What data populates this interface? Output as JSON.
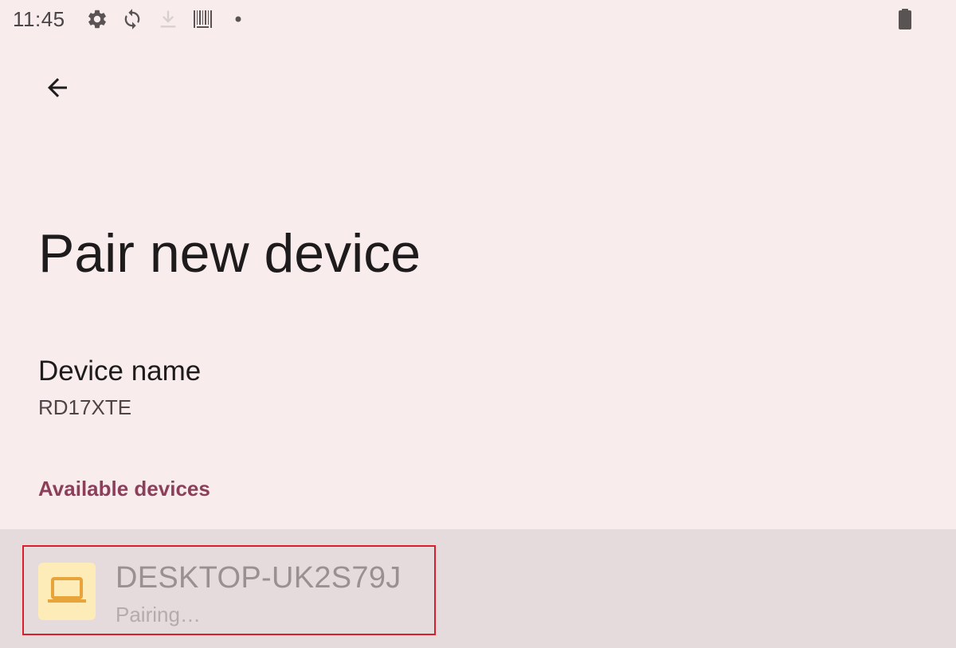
{
  "status_bar": {
    "time": "11:45",
    "icons": [
      "gear-icon",
      "sync-icon",
      "download-icon",
      "barcode-icon",
      "dot-icon",
      "battery-icon"
    ]
  },
  "toolbar": {
    "back_icon": "arrow-back-icon"
  },
  "page": {
    "title": "Pair new device"
  },
  "device_name": {
    "title": "Device name",
    "value": "RD17XTE"
  },
  "available_devices": {
    "header": "Available devices",
    "items": [
      {
        "name": "DESKTOP-UK2S79J",
        "status": "Pairing…",
        "icon": "laptop-icon",
        "icon_color": "#e8a33a",
        "tile_color": "#fdecb7",
        "highlighted": true
      }
    ]
  },
  "colors": {
    "background": "#f9ecec",
    "accent": "#8c3f5a",
    "row_pressed": "#e6dbdc",
    "highlight_border": "#d6202a"
  }
}
